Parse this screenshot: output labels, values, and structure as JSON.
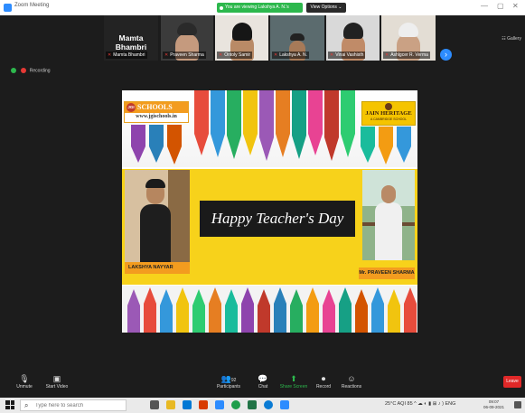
{
  "titlebar": {
    "app_title": "Zoom Meeting",
    "viewing_text": "You are viewing Lakshya A. N.'s screen",
    "view_options": "View Options ⌄",
    "controls": [
      "—",
      "▢",
      "✕"
    ]
  },
  "participants": {
    "featured_name": "Mamta Bhambri",
    "tiles": [
      {
        "name": "Mamta Bhambri"
      },
      {
        "name": "Praveen Sharma"
      },
      {
        "name": "Ontoly Samir"
      },
      {
        "name": "Lakshya A. N."
      },
      {
        "name": "Vinai Vashisth"
      },
      {
        "name": "Ashlgcer R. Verma"
      }
    ],
    "gallery_label": "☷ Gallery"
  },
  "recording": {
    "label": "Recording"
  },
  "shared_screen": {
    "jgi_badge": "JGI",
    "jgi_name": "SCHOOLS",
    "jgi_url": "www.jgischools.in",
    "jain_name": "JAIN HERITAGE",
    "jain_sub": "A CAMBRIDGE SCHOOL",
    "greeting": "Happy Teacher's Day",
    "name_left": "LAKSHYA NAYYAR",
    "name_right": "Mr. PRAVEEN SHARMA"
  },
  "toolbar": {
    "unmute": "Unmute",
    "start_video": "Start Video",
    "participants": "Participants",
    "participants_count": "92",
    "chat": "Chat",
    "share_screen": "Share Screen",
    "record": "Record",
    "reactions": "Reactions",
    "leave": "Leave"
  },
  "taskbar": {
    "search_placeholder": "Type here to search",
    "weather": "25°C  AQI 85",
    "lang": "ENG",
    "time": "09:07",
    "date": "06-09-2021"
  },
  "colors": {
    "zoom_green": "#2db84d",
    "zoom_blue": "#2d8cff",
    "leave_red": "#e02828",
    "banner_yellow": "#f7d21b",
    "orange_label": "#f39c1f"
  }
}
